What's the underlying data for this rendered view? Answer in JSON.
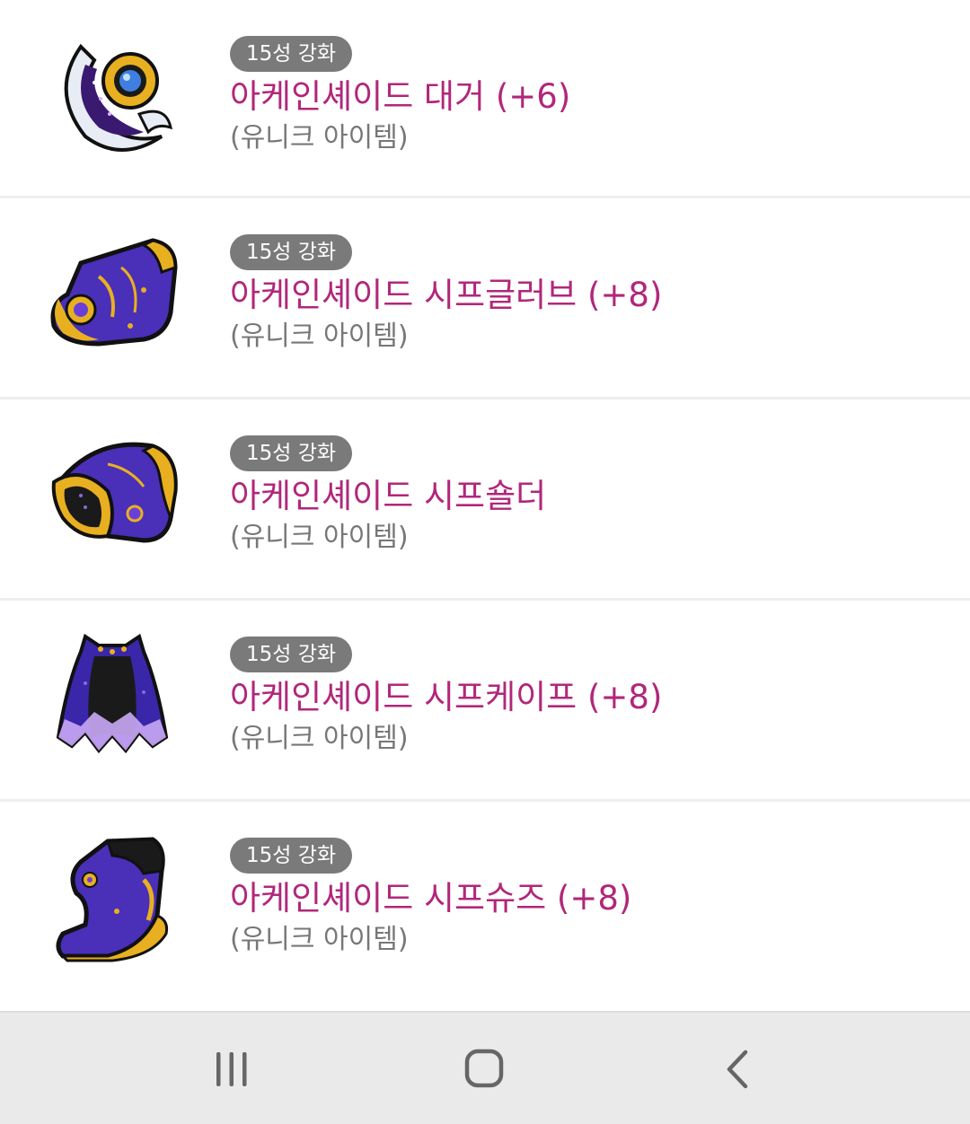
{
  "items": [
    {
      "badge": "15성 강화",
      "name": "아케인셰이드 대거 (+6)",
      "rarity": "(유니크 아이템)",
      "icon": "dagger-icon"
    },
    {
      "badge": "15성 강화",
      "name": "아케인셰이드 시프글러브 (+8)",
      "rarity": "(유니크 아이템)",
      "icon": "glove-icon"
    },
    {
      "badge": "15성 강화",
      "name": "아케인셰이드 시프숄더",
      "rarity": "(유니크 아이템)",
      "icon": "shoulder-icon"
    },
    {
      "badge": "15성 강화",
      "name": "아케인셰이드 시프케이프 (+8)",
      "rarity": "(유니크 아이템)",
      "icon": "cape-icon"
    },
    {
      "badge": "15성 강화",
      "name": "아케인셰이드 시프슈즈 (+8)",
      "rarity": "(유니크 아이템)",
      "icon": "shoes-icon"
    }
  ],
  "navbar": {
    "buttons": [
      "recent-apps-icon",
      "home-icon",
      "back-icon"
    ]
  },
  "colors": {
    "item_name": "#b1277a",
    "badge_bg": "#7a7a7a",
    "rarity_text": "#777777",
    "item_purple": "#4a2fb8",
    "item_gold": "#e8b020"
  }
}
